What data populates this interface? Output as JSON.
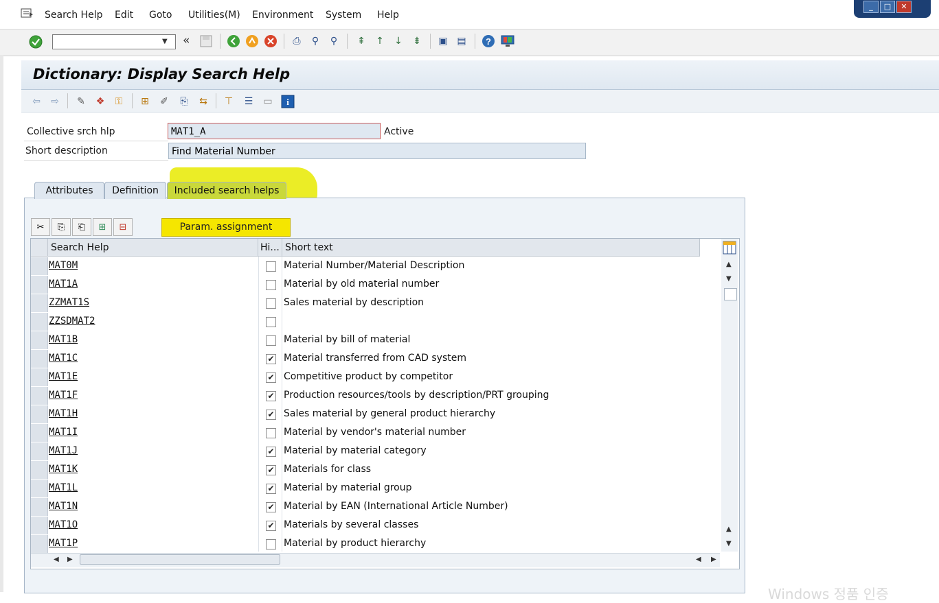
{
  "menu": {
    "items": [
      "Search Help",
      "Edit",
      "Goto",
      "Utilities(M)",
      "Environment",
      "System",
      "Help"
    ]
  },
  "window_controls": {
    "minimize": "_",
    "maximize": "□",
    "close": "✕"
  },
  "command_field": {
    "value": ""
  },
  "title": "Dictionary: Display Search Help",
  "form": {
    "collective_label": "Collective srch hlp",
    "collective_value": "MAT1_A",
    "status": "Active",
    "short_desc_label": "Short description",
    "short_desc_value": "Find Material Number"
  },
  "tabs": [
    "Attributes",
    "Definition",
    "Included search helps"
  ],
  "param_button": "Param. assignment",
  "table": {
    "headers": [
      "Search Help",
      "Hi...",
      "Short text"
    ],
    "rows": [
      {
        "name": "MAT0M",
        "checked": false,
        "text": "Material Number/Material Description"
      },
      {
        "name": "MAT1A",
        "checked": false,
        "text": "Material by old material number"
      },
      {
        "name": "ZZMAT1S",
        "checked": false,
        "text": "Sales material by description"
      },
      {
        "name": "ZZSDMAT2",
        "checked": false,
        "text": ""
      },
      {
        "name": "MAT1B",
        "checked": false,
        "text": "Material by bill of material"
      },
      {
        "name": "MAT1C",
        "checked": true,
        "text": "Material transferred from CAD system"
      },
      {
        "name": "MAT1E",
        "checked": true,
        "text": "Competitive product by competitor"
      },
      {
        "name": "MAT1F",
        "checked": true,
        "text": "Production resources/tools by description/PRT grouping"
      },
      {
        "name": "MAT1H",
        "checked": true,
        "text": "Sales material by general product hierarchy"
      },
      {
        "name": "MAT1I",
        "checked": false,
        "text": "Material by vendor's material number"
      },
      {
        "name": "MAT1J",
        "checked": true,
        "text": "Material by material category"
      },
      {
        "name": "MAT1K",
        "checked": true,
        "text": "Materials for class"
      },
      {
        "name": "MAT1L",
        "checked": true,
        "text": "Material by material group"
      },
      {
        "name": "MAT1N",
        "checked": true,
        "text": "Material by EAN (International Article Number)"
      },
      {
        "name": "MAT1O",
        "checked": true,
        "text": "Materials by several classes"
      },
      {
        "name": "MAT1P",
        "checked": false,
        "text": "Material by product hierarchy"
      }
    ]
  },
  "watermark": "Windows 정품 인증",
  "colors": {
    "highlight": "#e8ea00",
    "active_tab": "#c9d83a",
    "param_button": "#f5e600",
    "title_bg": "#dfe8f1"
  }
}
